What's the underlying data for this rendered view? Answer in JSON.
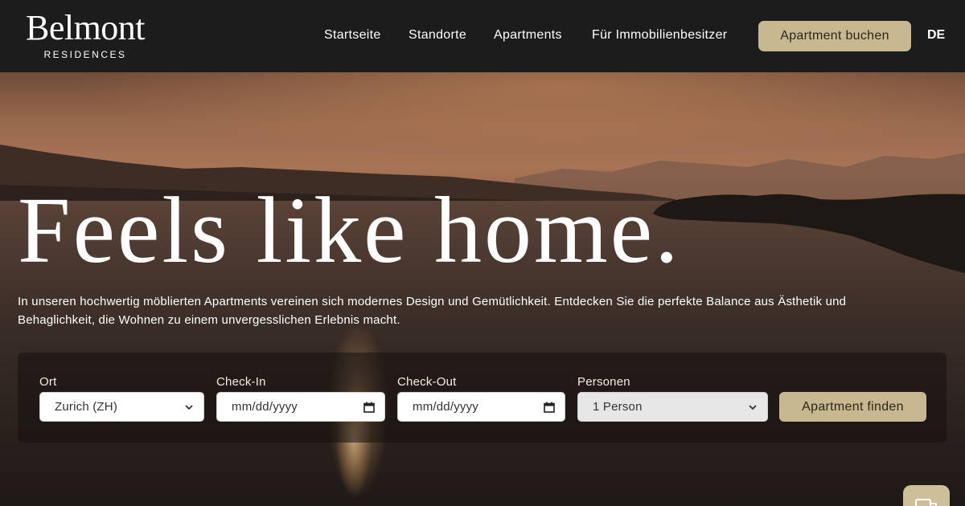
{
  "brand": {
    "name": "Belmont",
    "subtitle": "RESIDENCES"
  },
  "nav": {
    "items": [
      {
        "label": "Startseite"
      },
      {
        "label": "Standorte"
      },
      {
        "label": "Apartments"
      },
      {
        "label": "Für Immobilienbesitzer"
      }
    ],
    "book_label": "Apartment buchen",
    "language": "DE"
  },
  "hero": {
    "headline": "Feels like home.",
    "intro": "In unseren hochwertig möblierten Apartments vereinen sich modernes Design und Gemütlichkeit. Entdecken Sie die perfekte Balance aus Ästhetik und Behaglichkeit, die Wohnen zu einem unvergesslichen Erlebnis macht."
  },
  "search": {
    "location": {
      "label": "Ort",
      "value": "Zurich (ZH)"
    },
    "checkin": {
      "label": "Check-In",
      "placeholder": "mm/dd/yyyy"
    },
    "checkout": {
      "label": "Check-Out",
      "placeholder": "mm/dd/yyyy"
    },
    "persons": {
      "label": "Personen",
      "value": "1 Person"
    },
    "submit_label": "Apartment finden"
  },
  "colors": {
    "accent": "#c8b890",
    "header_bg": "#1c1c1c",
    "text_on_dark": "#ffffff"
  },
  "icons": {
    "chat": "chat-icon",
    "calendar": "calendar-icon",
    "dropdown": "chevron-down-icon"
  }
}
